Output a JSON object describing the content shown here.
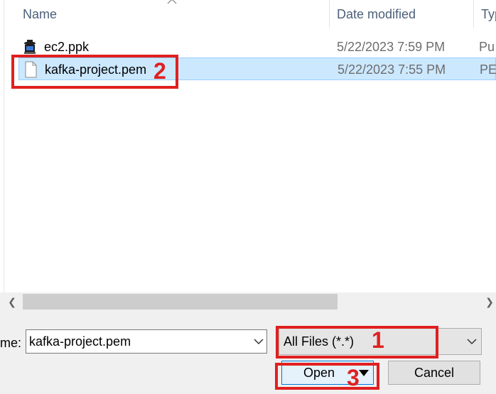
{
  "columns": {
    "name": "Name",
    "date_modified": "Date modified",
    "type": "Typ"
  },
  "files": [
    {
      "name": "ec2.ppk",
      "date": "5/22/2023 7:59 PM",
      "type": "Pu",
      "icon": "putty-key-icon",
      "selected": false
    },
    {
      "name": "kafka-project.pem",
      "date": "5/22/2023 7:55 PM",
      "type": "PE",
      "icon": "file-icon",
      "selected": true
    }
  ],
  "bottom": {
    "file_name_label": "me:",
    "file_name_value": "kafka-project.pem",
    "file_type_value": "All Files (*.*)",
    "open_label": "Open",
    "cancel_label": "Cancel"
  },
  "annotations": {
    "one": "1",
    "two": "2",
    "three": "3",
    "color": "#e02020"
  },
  "colors": {
    "selection_bg": "#cce8ff",
    "selection_border": "#99d1ff",
    "header_text": "#4c607a",
    "accent": "#0078d7"
  }
}
